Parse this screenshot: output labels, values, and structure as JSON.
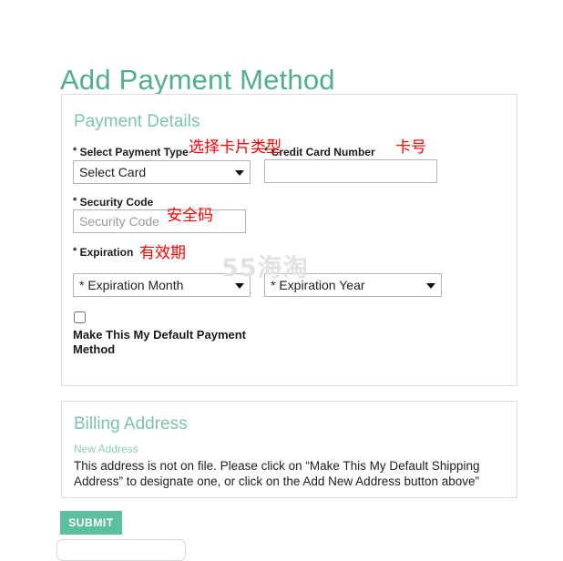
{
  "page": {
    "title": "Add Payment Method"
  },
  "payment_details": {
    "heading": "Payment Details",
    "fields": {
      "payment_type": {
        "label": "Select Payment Type",
        "required_marker": "*",
        "selected": "Select Card",
        "options": [
          "Select Card"
        ]
      },
      "card_number": {
        "label": "Credit Card Number",
        "required_marker": "*",
        "value": "",
        "placeholder": ""
      },
      "security_code": {
        "label": "Security Code",
        "required_marker": "*",
        "value": "",
        "placeholder": "Security Code"
      },
      "expiration": {
        "label": "Expiration",
        "required_marker": "*",
        "month": {
          "selected": "* Expiration Month",
          "options": [
            "* Expiration Month"
          ]
        },
        "year": {
          "selected": "* Expiration Year",
          "options": [
            "* Expiration Year"
          ]
        }
      }
    },
    "default_payment": {
      "label": "Make This My Default Payment Method",
      "checked": false
    }
  },
  "billing_address": {
    "heading": "Billing Address",
    "subheading": "New Address",
    "message": "This address is not on file. Please click on “Make This My Default Shipping Address” to designate one, or click on the Add New Address button above”"
  },
  "actions": {
    "submit_label": "SUBMIT"
  },
  "annotations": [
    {
      "id": "card-type",
      "text": "选择卡片类型"
    },
    {
      "id": "card-no",
      "text": "卡号"
    },
    {
      "id": "cvv",
      "text": "安全码"
    },
    {
      "id": "expiry",
      "text": "有效期"
    }
  ],
  "watermark": {
    "text": "55海淘"
  },
  "colors": {
    "title_green": "#52ae93",
    "heading_green": "#7dc3ae",
    "subheading_green": "#8fcbb8",
    "submit_green": "#5cbf9e",
    "annotation_red": "#ff0000",
    "panel_border": "#dcdcdc",
    "control_border": "#b4b4b4",
    "watermark_gray": "#e2e2e2"
  }
}
